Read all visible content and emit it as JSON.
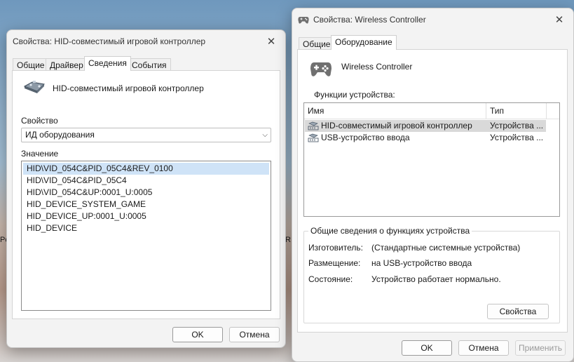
{
  "desktop": {
    "left_edge_text": "Pc",
    "right_edge_text": "R"
  },
  "hid_dialog": {
    "title": "Свойства: HID-совместимый игровой контроллер",
    "tabs": [
      {
        "label": "Общие",
        "active": false
      },
      {
        "label": "Драйвер",
        "active": false
      },
      {
        "label": "Сведения",
        "active": true
      },
      {
        "label": "События",
        "active": false
      }
    ],
    "device_name": "HID-совместимый игровой контроллер",
    "property_label": "Свойство",
    "property_value": "ИД оборудования",
    "value_label": "Значение",
    "values": [
      "HID\\VID_054C&PID_05C4&REV_0100",
      "HID\\VID_054C&PID_05C4",
      "HID\\VID_054C&UP:0001_U:0005",
      "HID_DEVICE_SYSTEM_GAME",
      "HID_DEVICE_UP:0001_U:0005",
      "HID_DEVICE"
    ],
    "ok_label": "OK",
    "cancel_label": "Отмена"
  },
  "wc_dialog": {
    "title": "Свойства: Wireless Controller",
    "tabs": [
      {
        "label": "Общие",
        "active": false
      },
      {
        "label": "Оборудование",
        "active": true
      }
    ],
    "device_name": "Wireless Controller",
    "functions_label": "Функции устройства:",
    "columns": {
      "name": "Имя",
      "type": "Тип"
    },
    "rows": [
      {
        "name": "HID-совместимый игровой контроллер",
        "type": "Устройства ..."
      },
      {
        "name": "USB-устройство ввода",
        "type": "Устройства ..."
      }
    ],
    "summary_title": "Общие сведения о функциях устройства",
    "manufacturer_label": "Изготовитель:",
    "manufacturer_value": "(Стандартные системные устройства)",
    "location_label": "Размещение:",
    "location_value": "на USB-устройство ввода",
    "status_label": "Состояние:",
    "status_value": "Устройство работает нормально.",
    "properties_button": "Свойства",
    "ok_label": "OK",
    "cancel_label": "Отмена",
    "apply_label": "Применить"
  }
}
